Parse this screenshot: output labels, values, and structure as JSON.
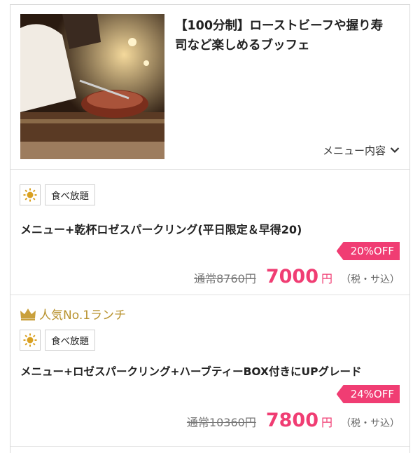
{
  "header": {
    "title_line1": "【100分制】ローストビーフや握り寿",
    "title_line2": "司など楽しめるブッフェ",
    "menu_toggle_label": "メニュー内容"
  },
  "plans": [
    {
      "tag": "食べ放題",
      "name": "メニュー+乾杯ロゼスパークリング(平日限定＆早得20)",
      "discount": "20%OFF",
      "regular_price": "通常8760円",
      "price": "7000",
      "yen": "円",
      "tax": "（税・サ込）"
    },
    {
      "ranking": "人気No.1ランチ",
      "tag": "食べ放題",
      "name": "メニュー+ロゼスパークリング+ハーブティーBOX付きにUPグレード",
      "discount": "24%OFF",
      "regular_price": "通常10360円",
      "price": "7800",
      "yen": "円",
      "tax": "（税・サ込）"
    }
  ],
  "colors": {
    "accent": "#f03d73",
    "gold": "#b8922e",
    "sun": "#d9a020"
  },
  "icons": [
    "chevron-down-icon",
    "sun-icon",
    "crown-icon"
  ]
}
